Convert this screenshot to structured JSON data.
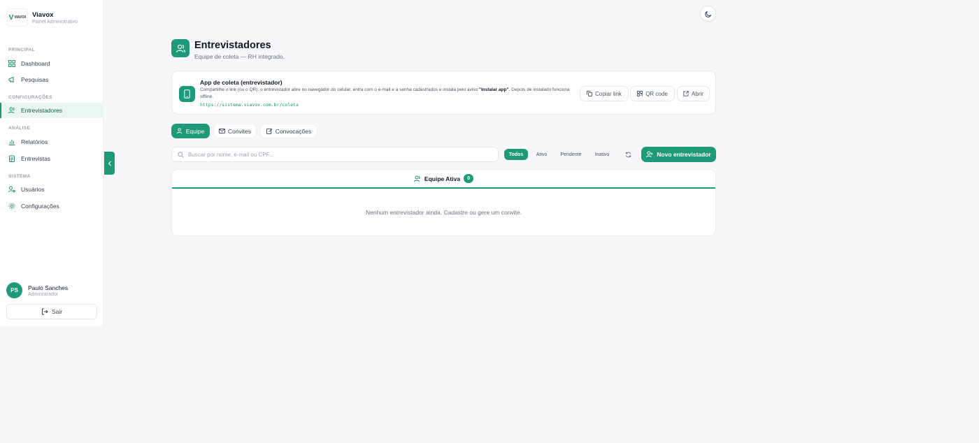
{
  "brand": {
    "logo_text": "VIAVOX",
    "title": "Viavox",
    "subtitle": "Painel Administrativo"
  },
  "nav": {
    "sections": {
      "principal": "PRINCIPAL",
      "configuracoes": "CONFIGURAÇÕES",
      "analise": "ANÁLISE",
      "sistema": "SISTEMA"
    },
    "items": {
      "dashboard": "Dashboard",
      "pesquisas": "Pesquisas",
      "entrevistadores": "Entrevistadores",
      "relatorios": "Relatórios",
      "entrevistas": "Entrevistas",
      "usuarios": "Usuários",
      "configuracoes": "Configurações"
    },
    "active": "entrevistadores"
  },
  "user": {
    "initials": "PS",
    "name": "Paulo Sanches",
    "role": "Administrador",
    "logout_label": "Sair"
  },
  "header": {
    "title": "Entrevistadores",
    "subtitle": "Equipe de coleta — RH integrado."
  },
  "app_card": {
    "title": "App de coleta (entrevistador)",
    "description_before": "Compartilhe o link (ou o QR): o entrevistador abre no navegador do celular, entra com o e-mail e a senha cadastrados e instala pelo aviso ",
    "description_bold": "\"Instalar app\"",
    "description_after": ". Depois de instalado funciona offline.",
    "link": "https://sistema.viavox.com.br/coleta",
    "buttons": {
      "copy": "Copiar link",
      "qr": "QR code",
      "open": "Abrir"
    }
  },
  "tabs": [
    {
      "label": "Equipe",
      "active": true
    },
    {
      "label": "Convites",
      "active": false
    },
    {
      "label": "Convocações",
      "active": false
    }
  ],
  "filters": {
    "search_placeholder": "Buscar por nome, e-mail ou CPF...",
    "status": [
      "Todos",
      "Ativo",
      "Pendente",
      "Inativo"
    ],
    "active_status": "Todos",
    "new_button": "Novo entrevistador"
  },
  "team": {
    "title": "Equipe Ativa",
    "count": "0",
    "empty_message": "Nenhum entrevistador ainda. Cadastre ou gere um convite."
  },
  "colors": {
    "accent": "#1f9a78",
    "background": "#f7f7f9",
    "surface": "#ffffff"
  },
  "icons": {
    "dashboard": "grid-icon",
    "pesquisas": "megaphone-icon",
    "entrevistadores": "users-icon",
    "relatorios": "bar-chart-icon",
    "entrevistas": "clipboard-icon",
    "usuarios": "user-cog-icon",
    "configuracoes": "gear-icon",
    "theme": "moon-icon",
    "phone": "smartphone-icon"
  }
}
